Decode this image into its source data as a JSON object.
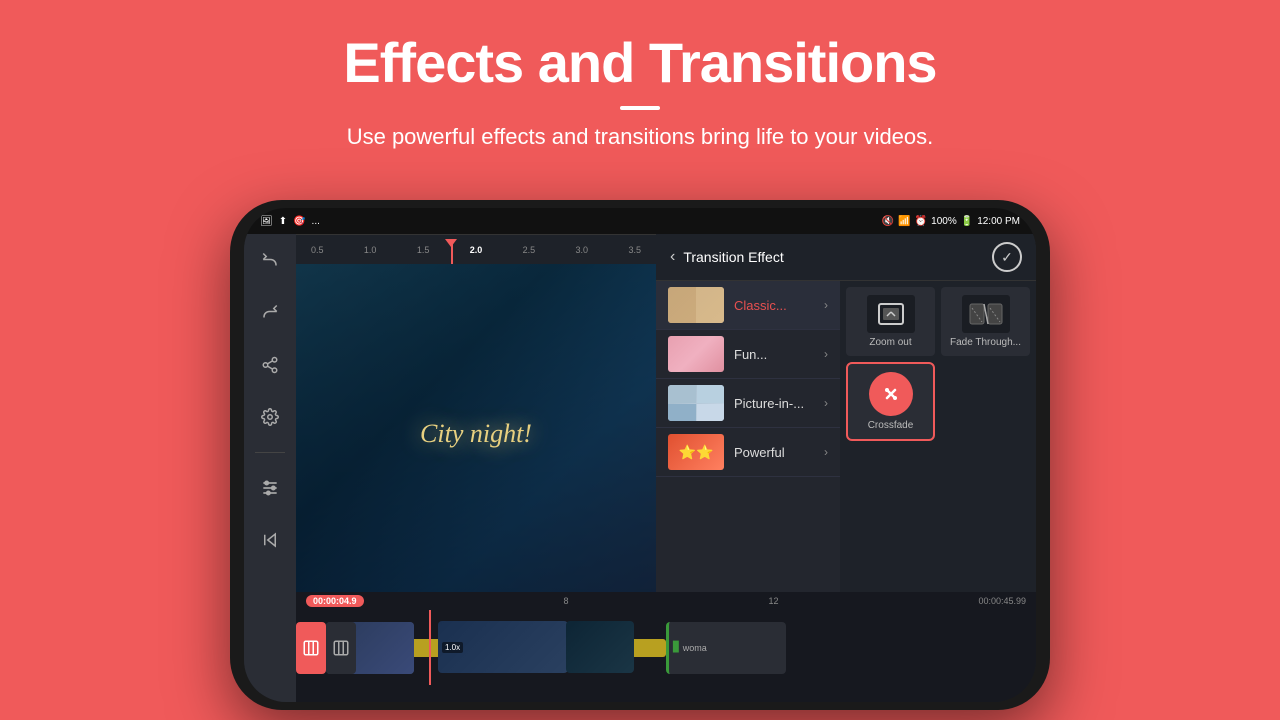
{
  "page": {
    "background_color": "#f05a5a",
    "title": "Effects and Transitions",
    "subtitle": "Use powerful effects and transitions bring life to your videos."
  },
  "status_bar": {
    "left_icons": [
      "🖼",
      "⬆",
      "🎯",
      "..."
    ],
    "right": "🔇 📶 🕐 100% 🔋 12:00 PM",
    "battery": "100%",
    "time": "12:00 PM"
  },
  "sidebar": {
    "icons": [
      "↩",
      "↪",
      "⬡",
      "⚙",
      "—",
      "≡",
      "⏮"
    ]
  },
  "video": {
    "overlay_text": "City night!"
  },
  "ruler": {
    "marks": [
      "0.5",
      "1.0",
      "1.5",
      "2.0",
      "2.5",
      "3.0",
      "3.5"
    ],
    "current_mark": "2.0"
  },
  "panel": {
    "title": "Transition Effect",
    "back_label": "‹",
    "confirm_icon": "✓",
    "categories": [
      {
        "label": "Classic...",
        "active": true
      },
      {
        "label": "Fun...",
        "active": false
      },
      {
        "label": "Picture-in-...",
        "active": false
      },
      {
        "label": "Powerful",
        "active": false
      }
    ],
    "effects": [
      {
        "label": "Zoom out",
        "icon": "zoom-out"
      },
      {
        "label": "Fade Through...",
        "icon": "fade-through"
      },
      {
        "label": "Crossfade",
        "icon": "crossfade"
      }
    ]
  },
  "timeline": {
    "start_time": "00:00:04.9",
    "end_time": "00:00:45.99",
    "clip2_multiplier": "1.0x",
    "audio_track": true,
    "green_label": "woma"
  }
}
